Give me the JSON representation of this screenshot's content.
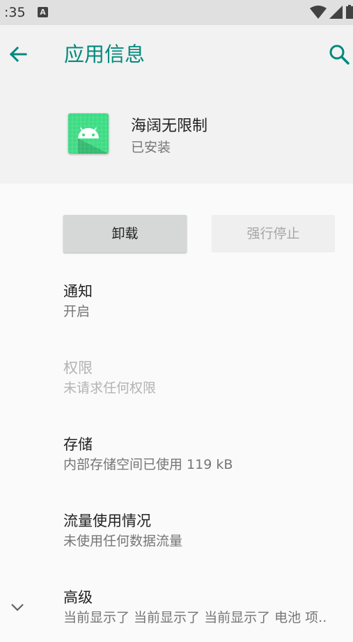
{
  "status_bar": {
    "time": ":35",
    "notification_icon": "A",
    "icons": [
      "wifi-icon",
      "signal-icon",
      "battery-icon"
    ]
  },
  "app_bar": {
    "title": "应用信息",
    "back_icon": "arrow-back-icon",
    "search_icon": "search-icon",
    "accent_color": "#00897b"
  },
  "app": {
    "name": "海阔无限制",
    "status": "已安装",
    "icon": "android-app-icon",
    "icon_color": "#3ddc84"
  },
  "buttons": {
    "uninstall": "卸载",
    "force_stop": "强行停止"
  },
  "settings": {
    "notifications": {
      "title": "通知",
      "summary": "开启"
    },
    "permissions": {
      "title": "权限",
      "summary": "未请求任何权限"
    },
    "storage": {
      "title": "存储",
      "summary": "内部存储空间已使用 119 kB"
    },
    "data_usage": {
      "title": "流量使用情况",
      "summary": "未使用任何数据流量"
    },
    "advanced": {
      "title": "高级",
      "summary": "当前显示了 当前显示了 当前显示了 电池 项.."
    }
  }
}
